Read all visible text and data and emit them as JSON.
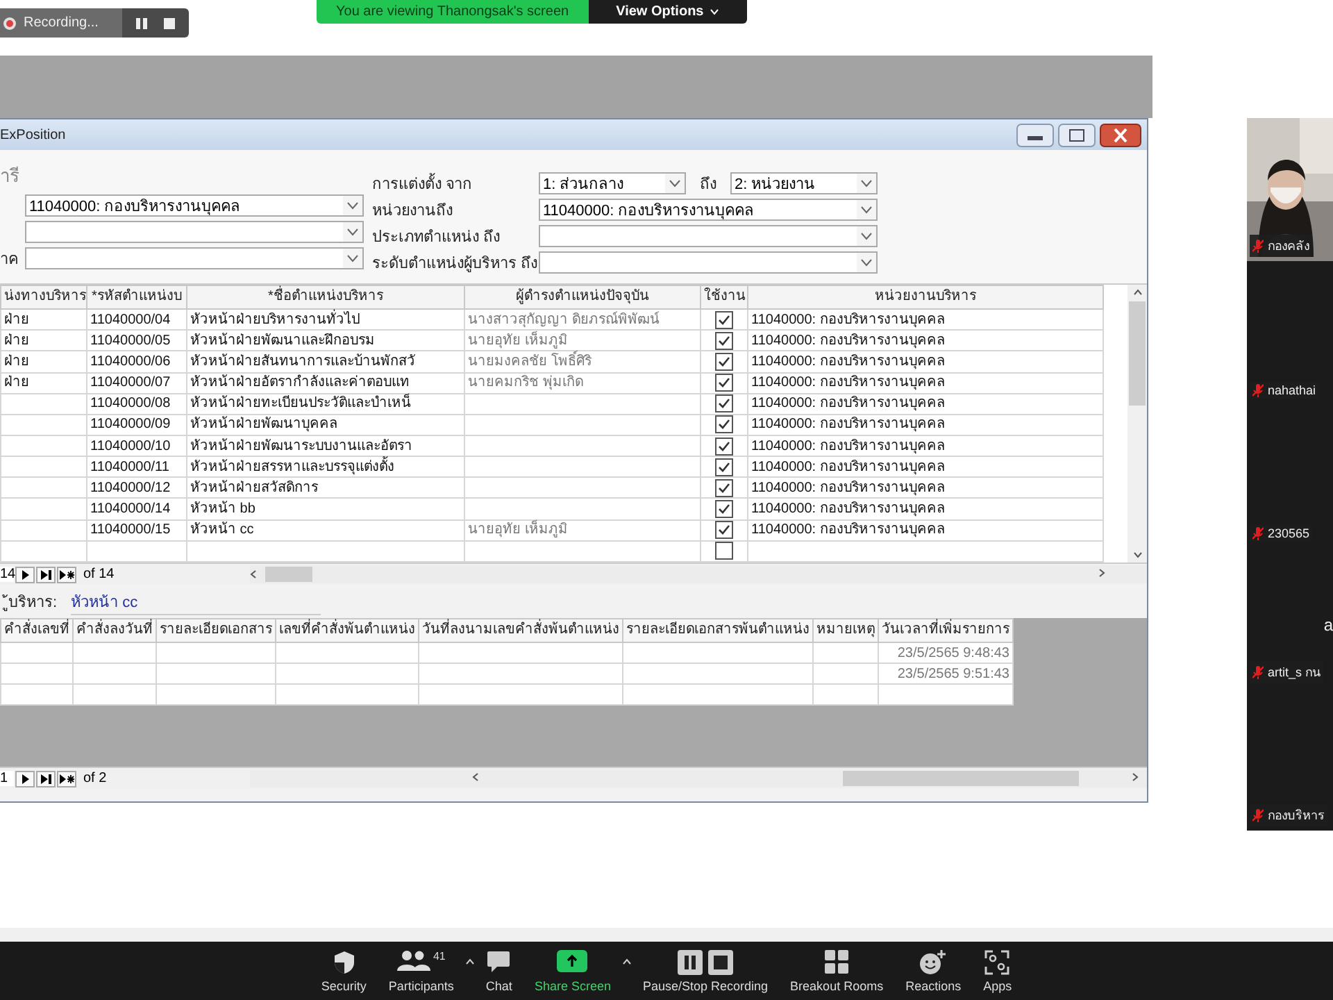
{
  "recording": {
    "label": "Recording..."
  },
  "share_banner": {
    "text": "You are viewing Thanongsak's screen",
    "button": "View Options"
  },
  "window": {
    "title": "ExPosition"
  },
  "filters": {
    "caption": "ารี",
    "left": [
      {
        "kind": "combo",
        "value": "11040000: กองบริหารงานบุคคล"
      },
      {
        "kind": "combo"
      },
      {
        "kind": "combo",
        "label": "าค"
      }
    ],
    "right": [
      {
        "label": "การแต่งตั้ง จาก",
        "value": "1: ส่วนกลาง",
        "to_label": "ถึง",
        "to_value": "2: หน่วยงาน"
      },
      {
        "label": "หน่วยงานถึง",
        "value": "11040000: กองบริหารงานบุคคล"
      },
      {
        "label": "ประเภทตำแหน่ง ถึง"
      },
      {
        "label": "ระดับตำแหน่งผู้บริหาร ถึง"
      }
    ]
  },
  "table": {
    "columns": [
      "น่งทางบริหาร",
      "*รหัสตำแหน่งบ",
      "*ชื่อตำแหน่งบริหาร",
      "ผู้ดำรงตำแหน่งปัจจุบัน",
      "ใช้งาน",
      "หน่วยงานบริหาร"
    ],
    "rows": [
      {
        "column_1": "ฝ่าย",
        "code": "11040000/04",
        "name": "หัวหน้าฝ่ายบริหารงานทั่วไป",
        "holder": "นางสาวสุกัญญา ดิยภรณ์พิพัฒน์",
        "in_use": true,
        "unit": "11040000: กองบริหารงานบุคคล"
      },
      {
        "column_1": "ฝ่าย",
        "code": "11040000/05",
        "name": "หัวหน้าฝ่ายพัฒนาและฝึกอบรม",
        "holder": "นายอุทัย เห็มภูมิ",
        "in_use": true,
        "unit": "11040000: กองบริหารงานบุคคล"
      },
      {
        "column_1": "ฝ่าย",
        "code": "11040000/06",
        "name": "หัวหน้าฝ่ายสันทนาการและบ้านพักสวั",
        "holder": "นายมงคลชัย โพธิ์ศิริ",
        "in_use": true,
        "unit": "11040000: กองบริหารงานบุคคล"
      },
      {
        "column_1": "ฝ่าย",
        "code": "11040000/07",
        "name": "หัวหน้าฝ่ายอัตรากำลังและค่าตอบแท",
        "holder": "นายคมกริช พุ่มเกิด",
        "in_use": true,
        "unit": "11040000: กองบริหารงานบุคคล"
      },
      {
        "code": "11040000/08",
        "name": "หัวหน้าฝ่ายทะเบียนประวัติและบำเหน็",
        "in_use": true,
        "unit": "11040000: กองบริหารงานบุคคล"
      },
      {
        "code": "11040000/09",
        "name": "หัวหน้าฝ่ายพัฒนาบุคคล",
        "in_use": true,
        "unit": "11040000: กองบริหารงานบุคคล"
      },
      {
        "code": "11040000/10",
        "name": "หัวหน้าฝ่ายพัฒนาระบบงานและอัตรา",
        "in_use": true,
        "unit": "11040000: กองบริหารงานบุคคล"
      },
      {
        "code": "11040000/11",
        "name": "หัวหน้าฝ่ายสรรหาและบรรจุแต่งตั้ง",
        "in_use": true,
        "unit": "11040000: กองบริหารงานบุคคล"
      },
      {
        "code": "11040000/12",
        "name": "หัวหน้าฝ่ายสวัสดิการ",
        "in_use": true,
        "unit": "11040000: กองบริหารงานบุคคล"
      },
      {
        "code": "11040000/14",
        "name": "หัวหน้า bb",
        "in_use": true,
        "unit": "11040000: กองบริหารงานบุคคล"
      },
      {
        "code": "11040000/15",
        "name": "หัวหน้า cc",
        "holder": "นายอุทัย เห็มภูมิ",
        "in_use": true,
        "unit": "11040000: กองบริหารงานบุคคล"
      },
      {
        "in_use": false
      }
    ],
    "navigation": {
      "record": "14",
      "total": "of 14"
    }
  },
  "subform": {
    "label": "ู้บริหาร:",
    "value": "หัวหน้า cc",
    "columns": [
      "คำสั่งเลขที่",
      "คำสั่งลงวันที่",
      "รายละเอียดเอกสาร",
      "เลขที่คำสั่งพ้นตำแหน่ง",
      "วันที่ลงนามเลขคำสั่งพ้นตำแหน่ง",
      "รายละเอียดเอกสารพ้นตำแหน่ง",
      "หมายเหตุ",
      "วันเวลาที่เพิ่มรายการ"
    ],
    "rows": [
      {
        "added": "23/5/2565 9:48:43"
      },
      {
        "added": "23/5/2565 9:51:43"
      }
    ],
    "navigation": {
      "record": "1",
      "total": "of 2"
    }
  },
  "participants": [
    {
      "name": "กองคลัง",
      "kind": "video",
      "muted": true
    },
    {
      "name": "nahathai",
      "kind": "blank",
      "muted": true
    },
    {
      "name": "230565",
      "kind": "blank",
      "muted": true
    },
    {
      "name": "artit_s กน",
      "kind": "blank",
      "muted": true,
      "center_text": "a"
    },
    {
      "name": "กองบริหาร",
      "kind": "blank",
      "muted": true
    }
  ],
  "toolbar": [
    {
      "kind": "security",
      "label": "Security"
    },
    {
      "kind": "participants",
      "label": "Participants",
      "count": "41",
      "caret": true
    },
    {
      "kind": "chat",
      "label": "Chat"
    },
    {
      "kind": "share",
      "label": "Share Screen",
      "caret": true
    },
    {
      "kind": "record",
      "label": "Pause/Stop Recording"
    },
    {
      "kind": "breakout",
      "label": "Breakout Rooms"
    },
    {
      "kind": "reactions",
      "label": "Reactions"
    },
    {
      "kind": "apps",
      "label": "Apps"
    }
  ]
}
